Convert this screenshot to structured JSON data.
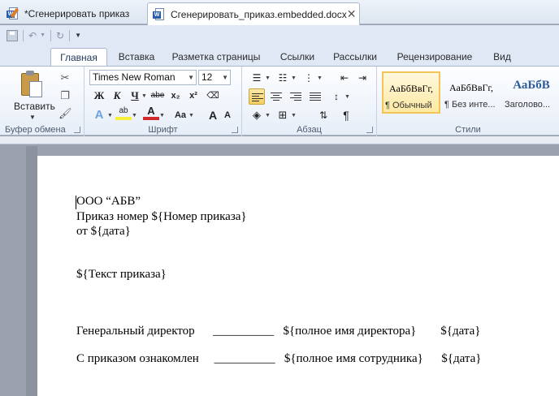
{
  "window": {
    "tabs": [
      {
        "label": "*Сгенерировать приказ",
        "active": false
      },
      {
        "label": "Сгенерировать_приказ.embedded.docx",
        "active": true
      }
    ],
    "close_glyph": "✕"
  },
  "ribbon": {
    "tabs": [
      "Главная",
      "Вставка",
      "Разметка страницы",
      "Ссылки",
      "Рассылки",
      "Рецензирование",
      "Вид"
    ],
    "active_tab": "Главная",
    "clipboard": {
      "paste_label": "Вставить",
      "group_label": "Буфер обмена"
    },
    "font": {
      "family": "Times New Roman",
      "size": "12",
      "group_label": "Шрифт",
      "bold": "Ж",
      "italic": "К",
      "underline": "Ч",
      "strike": "abe",
      "sub": "x₂",
      "sup": "x²",
      "case": "Aa",
      "grow": "A",
      "shrink": "A"
    },
    "paragraph": {
      "group_label": "Абзац",
      "pilcrow": "¶"
    },
    "styles": {
      "group_label": "Стили",
      "items": [
        {
          "sample": "АаБбВвГг,",
          "name": "¶ Обычный",
          "selected": true
        },
        {
          "sample": "АаБбВвГг,",
          "name": "¶ Без инте...",
          "selected": false
        },
        {
          "sample": "АаБбВ",
          "name": "Заголово...",
          "selected": false
        }
      ]
    }
  },
  "document": {
    "lines": [
      "ООО “АБВ”",
      "Приказ номер ${Номер приказа}",
      "от ${дата}",
      "${Текст приказа}",
      "Генеральный директор      __________   ${полное имя директора}        ${дата}",
      "С приказом ознакомлен     __________   ${полное имя сотрудника}      ${дата}"
    ]
  },
  "colors": {
    "accent": "#2a5caa",
    "selected_style": "#f2c556"
  }
}
